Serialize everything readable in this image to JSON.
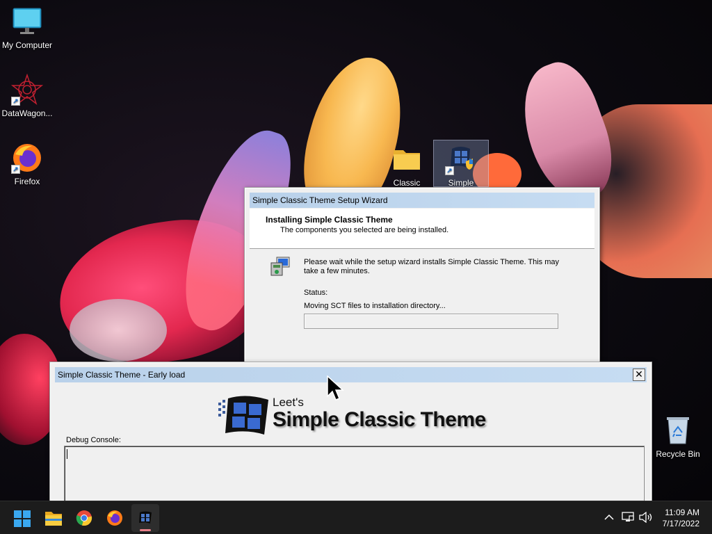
{
  "desktop": {
    "icons": [
      {
        "label": "My Computer",
        "icon": "monitor-icon"
      },
      {
        "label": "DataWagon...",
        "icon": "datawagon-icon"
      },
      {
        "label": "Firefox",
        "icon": "firefox-icon"
      },
      {
        "label": "Classic",
        "icon": "folder-icon"
      },
      {
        "label": "Simple",
        "icon": "windows-flag-icon"
      },
      {
        "label": "Recycle Bin",
        "icon": "recycle-bin-icon"
      }
    ]
  },
  "setup_wizard": {
    "title": "Simple Classic Theme Setup Wizard",
    "heading": "Installing Simple Classic Theme",
    "subheading": "The components you selected are being installed.",
    "message": "Please wait while the setup wizard installs Simple Classic Theme. This may take a few minutes.",
    "status_label": "Status:",
    "status_text": "Moving SCT files to installation directory...",
    "progress": 0
  },
  "early_load": {
    "title": "Simple Classic Theme - Early load",
    "close_label": "✕",
    "logo_small": "Leet's",
    "logo_big": "Simple Classic Theme",
    "console_label": "Debug Console:",
    "console_text": ""
  },
  "taskbar": {
    "buttons": [
      {
        "name": "start",
        "icon": "windows-start-icon"
      },
      {
        "name": "file-explorer",
        "icon": "folder-icon"
      },
      {
        "name": "chrome",
        "icon": "chrome-icon"
      },
      {
        "name": "firefox",
        "icon": "firefox-icon"
      },
      {
        "name": "simple-classic-theme",
        "icon": "windows-flag-icon",
        "active": true
      }
    ],
    "tray": {
      "chevron": "^",
      "time": "11:09 AM",
      "date": "7/17/2022"
    }
  },
  "colors": {
    "titlebar": "#b9d1ea",
    "window_face": "#f0f0f0",
    "taskbar": "#1c1c1c",
    "active_indicator": "#e8808a"
  }
}
